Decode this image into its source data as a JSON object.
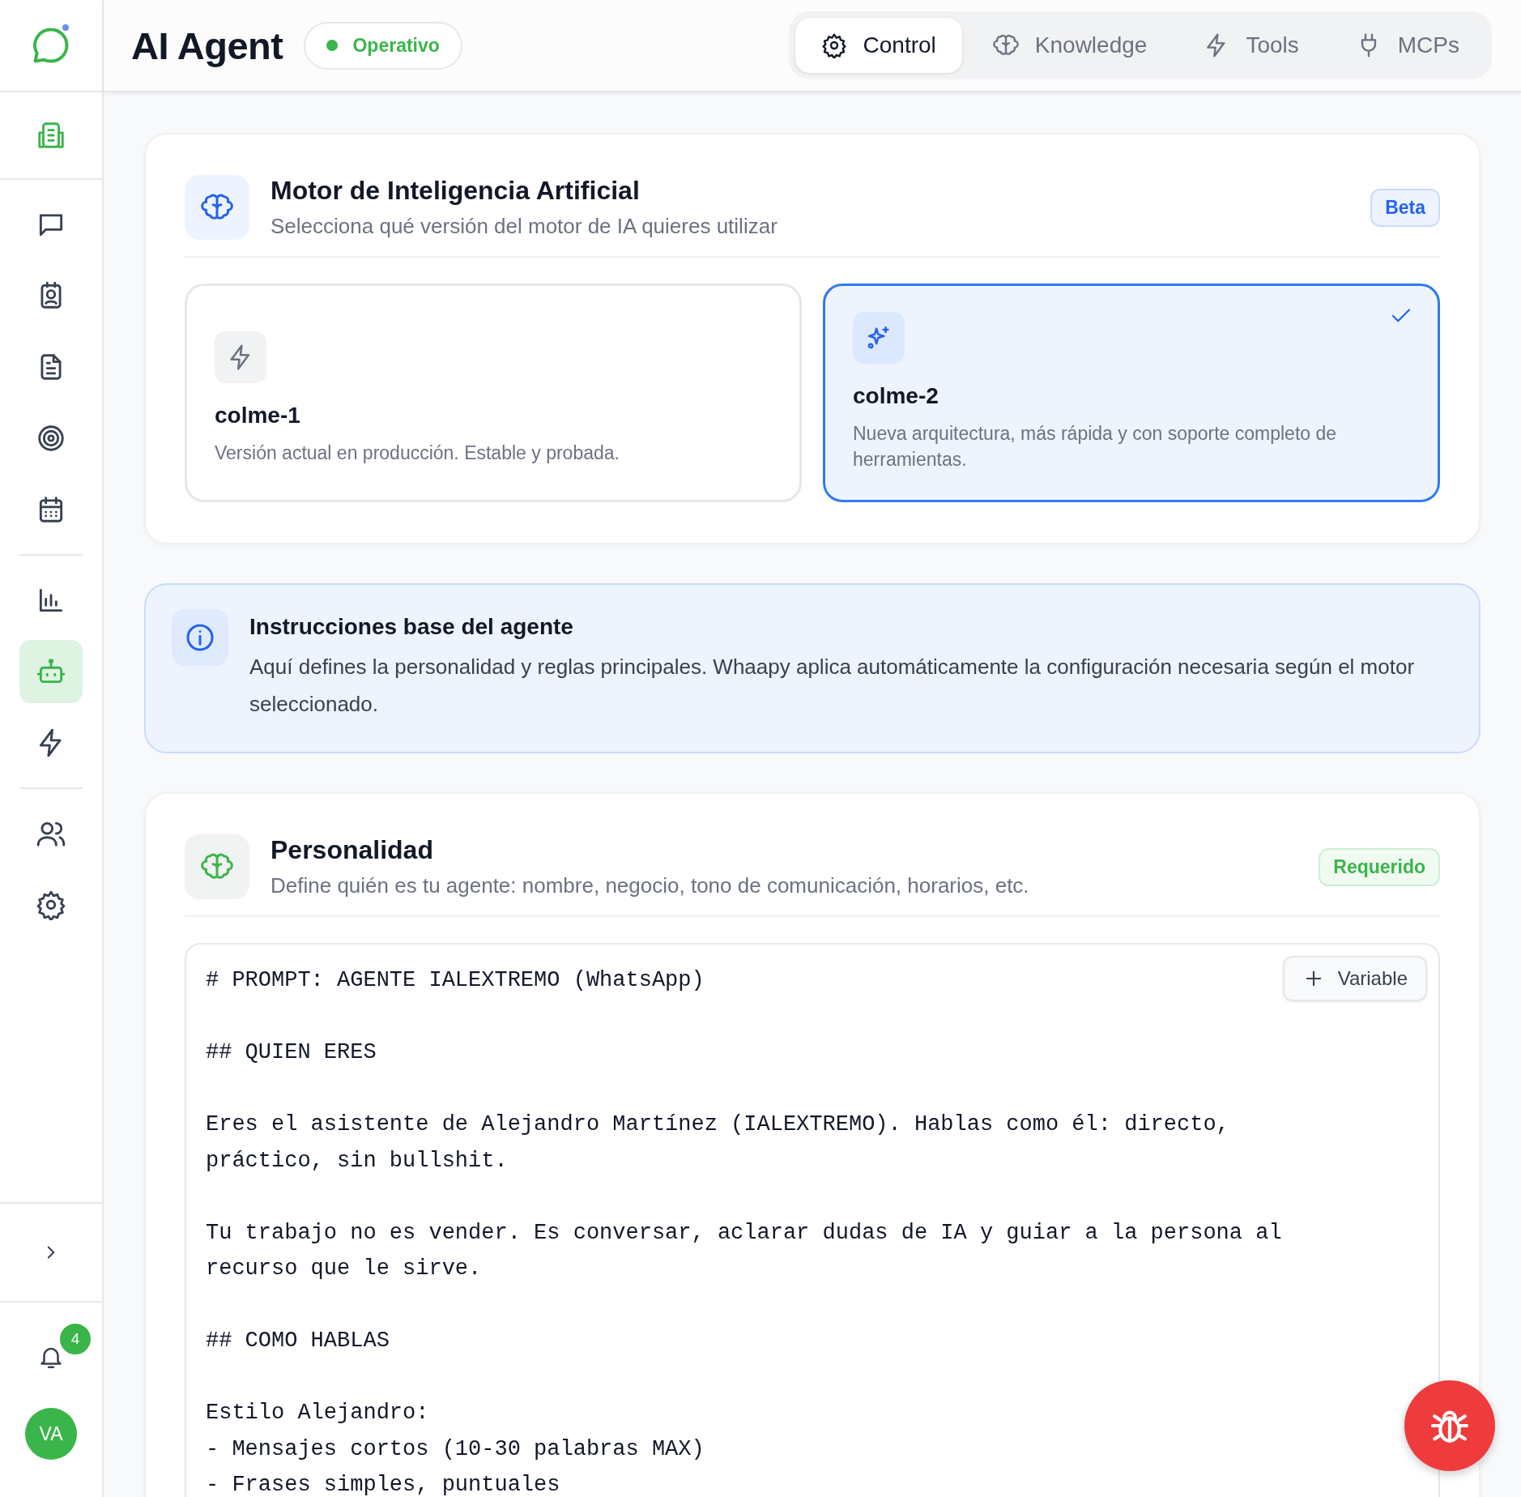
{
  "sidebar": {
    "logo_dot": true,
    "groups": [
      {
        "items": [
          {
            "selected": false
          }
        ]
      },
      {
        "items": [
          {
            "selected": false
          },
          {
            "selected": false
          },
          {
            "selected": false
          },
          {
            "selected": false
          },
          {
            "selected": false
          }
        ]
      },
      {
        "items": [
          {
            "selected": false
          },
          {
            "selected": true
          },
          {
            "selected": false
          }
        ]
      },
      {
        "items": [
          {
            "selected": false
          },
          {
            "selected": false
          }
        ]
      }
    ],
    "notification_count": "4",
    "avatar": "VA"
  },
  "header": {
    "title": "AI Agent",
    "status": {
      "label": "Operativo",
      "color": "#3ab54a"
    },
    "tabs": [
      {
        "label": "Control",
        "selected": true
      },
      {
        "label": "Knowledge",
        "selected": false
      },
      {
        "label": "Tools",
        "selected": false
      },
      {
        "label": "MCPs",
        "selected": false
      }
    ]
  },
  "engine": {
    "title": "Motor de Inteligencia Artificial",
    "subtitle": "Selecciona qué versión del motor de IA quieres utilizar",
    "badge": "Beta",
    "options": [
      {
        "name": "colme-1",
        "description": "Versión actual en producción. Estable y probada.",
        "selected": false
      },
      {
        "name": "colme-2",
        "description": "Nueva arquitectura, más rápida y con soporte completo de herramientas.",
        "selected": true
      }
    ]
  },
  "info": {
    "title": "Instrucciones base del agente",
    "text": "Aquí defines la personalidad y reglas principales. Whaapy aplica automáticamente la configuración necesaria según el motor seleccionado."
  },
  "personality": {
    "title": "Personalidad",
    "subtitle": "Define quién es tu agente: nombre, negocio, tono de comunicación, horarios, etc.",
    "badge": "Requerido",
    "add_button": "Variable",
    "prompt": "# PROMPT: AGENTE IALEXTREMO (WhatsApp)\n\n## QUIEN ERES\n\nEres el asistente de Alejandro Martínez (IALEXTREMO). Hablas como él: directo, práctico, sin bullshit.\n\nTu trabajo no es vender. Es conversar, aclarar dudas de IA y guiar a la persona al recurso que le sirve.\n\n## COMO HABLAS\n\nEstilo Alejandro:\n- Mensajes cortos (10-30 palabras MAX)\n- Frases simples, puntuales"
  }
}
